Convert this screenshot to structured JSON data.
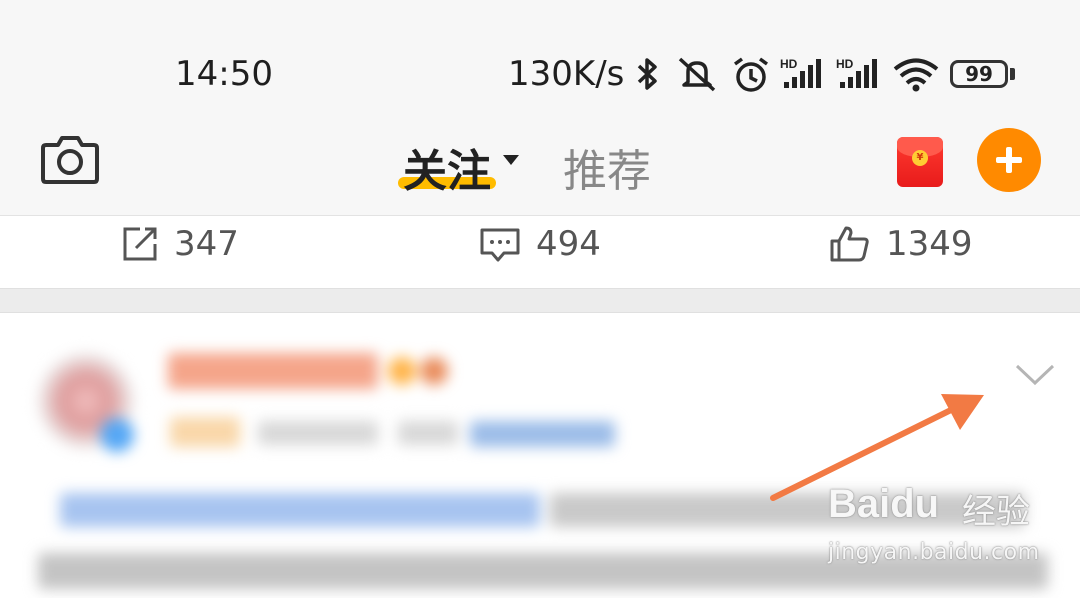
{
  "status_bar": {
    "time": "14:50",
    "net_speed": "130K/s",
    "battery": "99",
    "icons": [
      "bluetooth-icon",
      "mute-icon",
      "alarm-icon",
      "signal-hd-1-icon",
      "signal-hd-2-icon",
      "wifi-icon",
      "battery-icon"
    ]
  },
  "topnav": {
    "camera_icon": "camera-icon",
    "tabs": [
      {
        "label": "关注",
        "active": true
      },
      {
        "label": "推荐",
        "active": false
      }
    ],
    "accent": "#ffbc00",
    "plus_color": "#ff8a00",
    "redpacket_color": "#e81b1b"
  },
  "post_actions": {
    "repost_count": "347",
    "comment_count": "494",
    "like_count": "1349"
  },
  "watermark": {
    "brand": "Baidu",
    "product": "经验",
    "url": "jingyan.baidu.com"
  }
}
